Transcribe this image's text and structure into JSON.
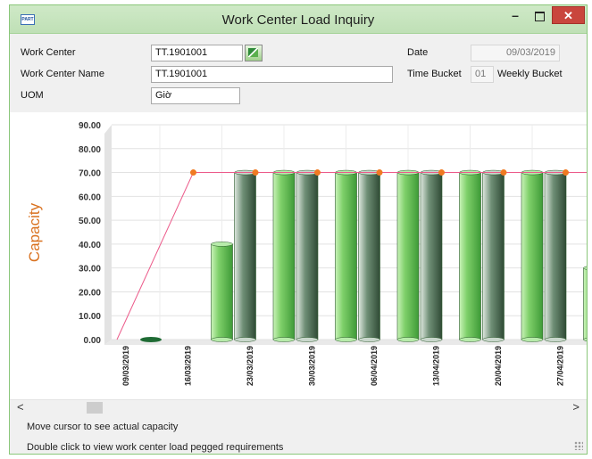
{
  "window": {
    "title": "Work Center Load Inquiry",
    "logo_text": "PART",
    "minimize": "–",
    "close": "✕"
  },
  "form": {
    "work_center_label": "Work Center",
    "work_center_value": "TT.1901001",
    "work_center_name_label": "Work Center Name",
    "work_center_name_value": "TT.1901001",
    "uom_label": "UOM",
    "uom_value": "Giờ",
    "date_label": "Date",
    "date_value": "09/03/2019",
    "time_bucket_label": "Time Bucket",
    "time_bucket_code": "01",
    "time_bucket_value": "Weekly Bucket"
  },
  "status": {
    "line1": "Move cursor to see actual capacity",
    "line2": "Double click to view work center load pegged requirements"
  },
  "scrollbar": {
    "left_arrow": "<",
    "right_arrow": ">"
  },
  "colors": {
    "load_bar": "#7fd06a",
    "capacity_bar": "#6f8f76",
    "capacity_line": "#ec5a8a",
    "marker": "#f07a22",
    "axis_title": "#d9711f"
  },
  "chart_data": {
    "type": "bar",
    "ylabel": "Capacity",
    "ylim": [
      0,
      90
    ],
    "yticks": [
      "90.00",
      "80.00",
      "70.00",
      "60.00",
      "50.00",
      "40.00",
      "30.00",
      "20.00",
      "10.00",
      "0.00"
    ],
    "categories": [
      "09/03/2019",
      "16/03/2019",
      "23/03/2019",
      "30/03/2019",
      "06/04/2019",
      "13/04/2019",
      "20/04/2019",
      "27/04/2019"
    ],
    "series": [
      {
        "values": [
          0,
          40,
          70,
          70,
          70,
          70,
          70,
          30
        ]
      },
      {
        "values": [
          0,
          70,
          70,
          70,
          70,
          70,
          70,
          70
        ]
      }
    ],
    "capacity_line": [
      0,
      70,
      70,
      70,
      70,
      70,
      70,
      70
    ],
    "grid": true
  }
}
